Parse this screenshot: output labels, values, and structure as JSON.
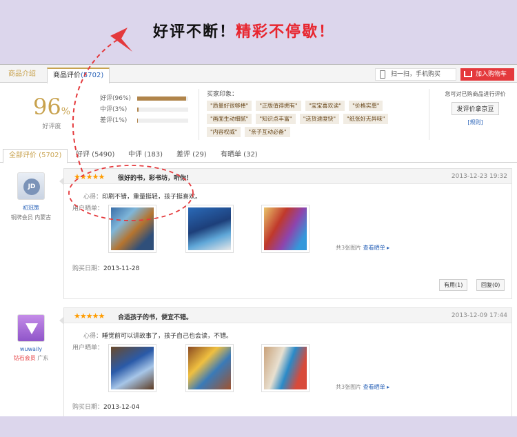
{
  "banner": {
    "part1": "好评不断！",
    "part2": "精彩不停歇！"
  },
  "top_tabs": [
    {
      "label": "商品介绍"
    },
    {
      "label": "商品评价",
      "count": "(5702)"
    }
  ],
  "scan_label": "扫一扫，手机购买",
  "cart_label": "加入购物车",
  "summary": {
    "rate": "96",
    "rate_unit": "%",
    "rate_label": "好评度",
    "bars": [
      {
        "label": "好评(96%)",
        "value": 0.96
      },
      {
        "label": "中评(3%)",
        "value": 0.03
      },
      {
        "label": "差评(1%)",
        "value": 0.01
      }
    ],
    "impress_title": "买家印象：",
    "tags": [
      "\"质量好很够棒\"",
      "\"正版值得拥有\"",
      "\"宝宝喜欢读\"",
      "\"价格实惠\"",
      "\"画面生动细腻\"",
      "\"知识点丰富\"",
      "\"送货速度快\"",
      "\"纸张好无异味\"",
      "\"内容权威\"",
      "\"亲子互动必备\""
    ],
    "buyer_prompt": "您可对已购商品进行评价",
    "review_button": "发评价拿京豆",
    "rule_link": "[规则]"
  },
  "filter_tabs": [
    "全部评价 (5702)",
    "好评 (5490)",
    "中评 (183)",
    "差评 (29)",
    "有晒单 (32)"
  ],
  "reviews": [
    {
      "user": "初冠策",
      "level": "铜牌会员",
      "region": "内蒙古",
      "stars": "★★★★★",
      "title": "很好的书，彩书坊，听你！",
      "date": "2013-12-23 19:32",
      "heart_label": "心得：",
      "heart": "印刷不错，重量挺轻，孩子挺喜欢。",
      "photos_label": "用户晒单：",
      "photo_count": "共3张图片",
      "photo_link": "查看晒单 ▸",
      "buy_label": "购买日期：",
      "buy_date": "2013-11-28",
      "useful": "有用(1)",
      "reply": "回复(0)"
    },
    {
      "user": "wuwaily",
      "level": "钻石会员",
      "region": "广东",
      "stars": "★★★★★",
      "title": "合适孩子的书，便宜不错。",
      "date": "2013-12-09 17:44",
      "heart_label": "心得：",
      "heart": "睡觉前可以讲故事了，孩子自己也会读，不错。",
      "photos_label": "用户晒单：",
      "photo_count": "共3张图片",
      "photo_link": "查看晒单 ▸",
      "buy_label": "购买日期：",
      "buy_date": "2013-12-04"
    }
  ],
  "colors": {
    "accent": "#c8a24e",
    "link": "#2a63b8",
    "red": "#e4393c",
    "star": "#ff9c00",
    "bg": "#dcd6ec"
  }
}
